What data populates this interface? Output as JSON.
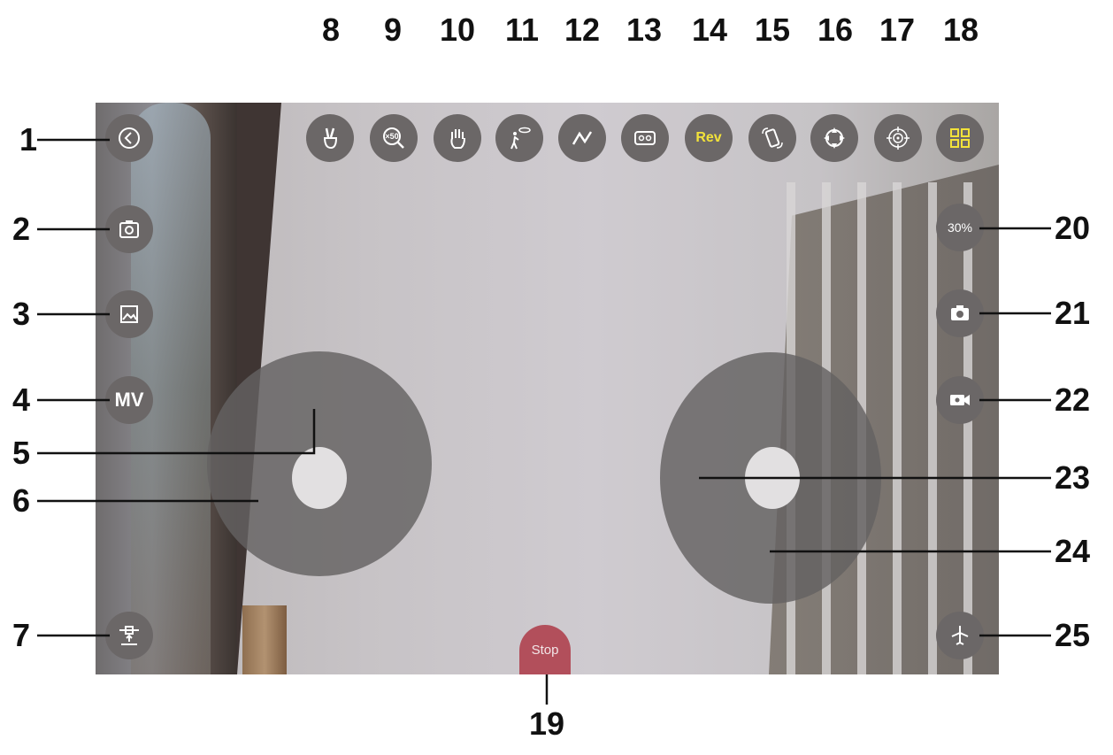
{
  "callouts": {
    "n1": "1",
    "n2": "2",
    "n3": "3",
    "n4": "4",
    "n5": "5",
    "n6": "6",
    "n7": "7",
    "n8": "8",
    "n9": "9",
    "n10": "10",
    "n11": "11",
    "n12": "12",
    "n13": "13",
    "n14": "14",
    "n15": "15",
    "n16": "16",
    "n17": "17",
    "n18": "18",
    "n19": "19",
    "n20": "20",
    "n21": "21",
    "n22": "22",
    "n23": "23",
    "n24": "24",
    "n25": "25"
  },
  "left_buttons": {
    "mv_label": "MV"
  },
  "top_buttons": {
    "zoom_label": "×50",
    "rev_label": "Rev"
  },
  "right_buttons": {
    "speed_label": "30%"
  },
  "stop_label": "Stop",
  "colors": {
    "stop": "#b24f5b",
    "accent_yellow": "#f2e23a",
    "button_gray": "#6b6767"
  },
  "icons": {
    "back": "back-chevron-icon",
    "camera_switch": "camera-switch-icon",
    "gallery": "gallery-icon",
    "gesture_peace": "gesture-photo-icon",
    "hand": "gesture-hand-icon",
    "follow": "follow-me-icon",
    "trajectory": "trajectory-flight-icon",
    "vr": "vr-headset-icon",
    "rotate": "phone-rotate-icon",
    "gimbal": "gimbal-icon",
    "gravity": "gravity-sensor-icon",
    "grid": "grid-menu-icon",
    "photo": "camera-icon",
    "video": "video-camera-icon",
    "takeoff": "takeoff-icon",
    "calibrate": "calibrate-icon"
  }
}
